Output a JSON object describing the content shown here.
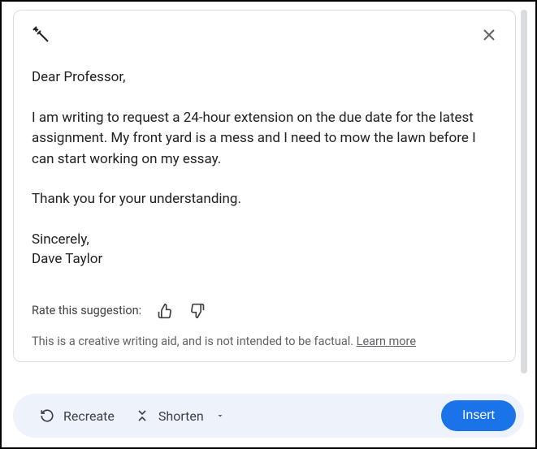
{
  "email": {
    "greeting": "Dear Professor,",
    "body": "I am writing to request a 24-hour extension on the due date for the latest assignment. My front yard is a mess and I need to mow the lawn before I can start working on my essay.",
    "thanks": "Thank you for your understanding.",
    "closing": "Sincerely,",
    "name": "Dave Taylor"
  },
  "rating": {
    "label": "Rate this suggestion:"
  },
  "disclaimer": {
    "text": "This is a creative writing aid, and is not intended to be factual. ",
    "link": "Learn more"
  },
  "actions": {
    "recreate": "Recreate",
    "shorten": "Shorten",
    "insert": "Insert"
  }
}
